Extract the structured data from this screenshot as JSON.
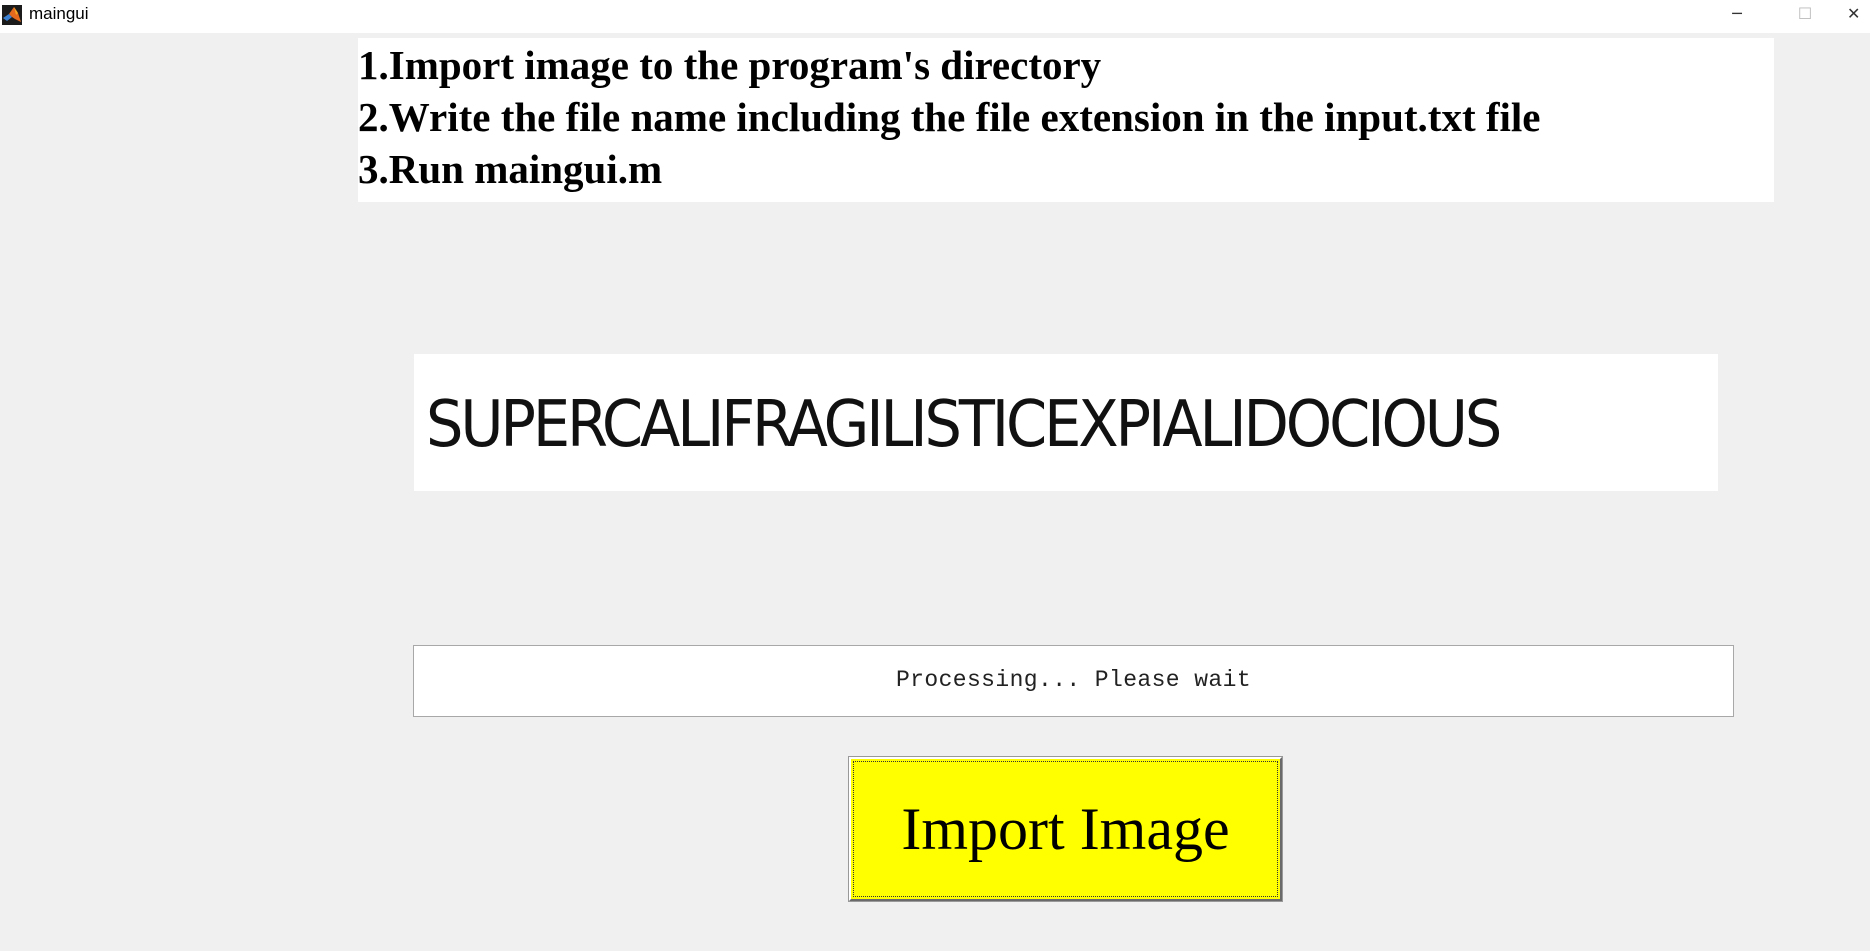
{
  "window": {
    "title": "maingui",
    "app_icon": "matlab-icon",
    "controls": {
      "minimize": "─",
      "maximize": "☐",
      "close": "✕"
    }
  },
  "instructions": {
    "lines": [
      "1.Import image to the program's directory",
      "2.Write the file name including the file extension in the input.txt file",
      "3.Run maingui.m"
    ]
  },
  "image_preview": {
    "text": "SUPERCALIFRAGILISTICEXPIALIDOCIOUS"
  },
  "status": {
    "text": "Processing... Please wait"
  },
  "import_button": {
    "label": "Import Image",
    "color": "#ffff00"
  }
}
